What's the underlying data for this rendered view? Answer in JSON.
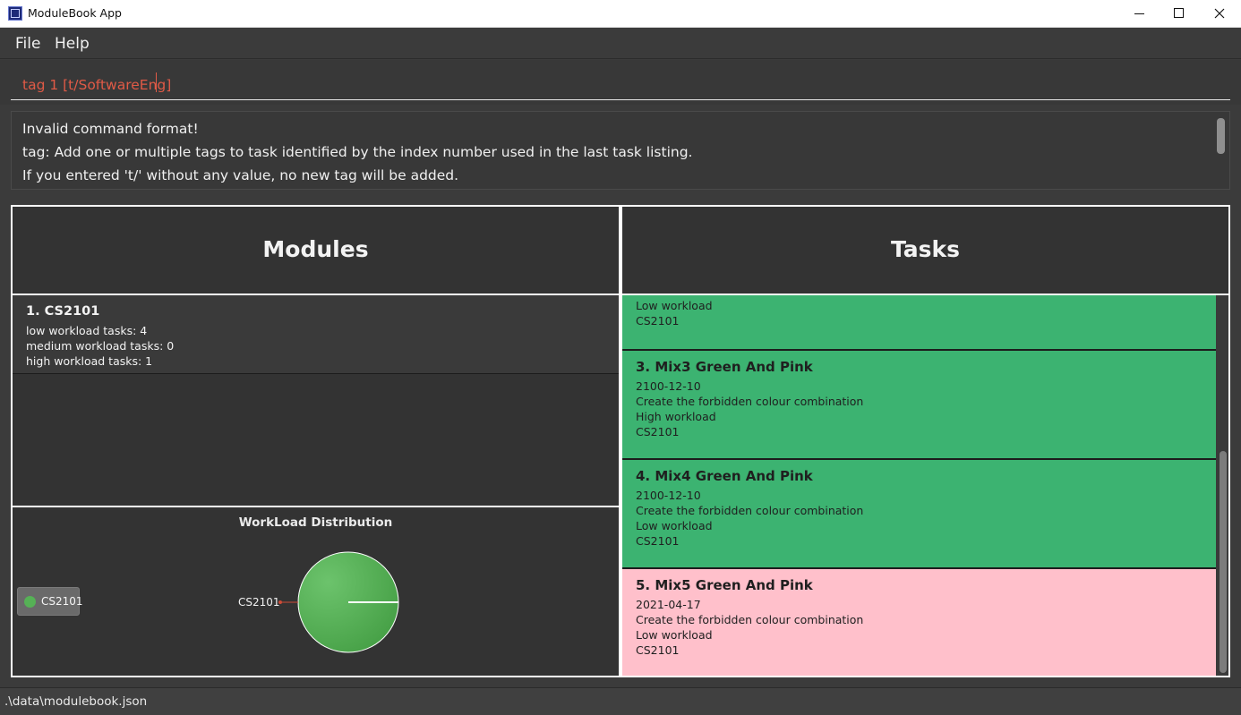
{
  "window": {
    "title": "ModuleBook App"
  },
  "menu": {
    "file": "File",
    "help": "Help"
  },
  "command": {
    "value": "tag 1 [t/SoftwareEng]"
  },
  "result": {
    "lines": [
      "Invalid command format!",
      "tag: Add one or multiple tags to task identified by the index number used in the last task listing.",
      "If you entered 't/' without any value, no new tag will be added."
    ]
  },
  "modules": {
    "title": "Modules",
    "items": [
      {
        "name": "1.  CS2101",
        "low": "low workload tasks: 4",
        "medium": "medium workload tasks: 0",
        "high": "high workload tasks: 1"
      }
    ]
  },
  "workload_chart": {
    "title": "WorkLoad Distribution",
    "legend": "CS2101",
    "slice_label": "CS2101"
  },
  "chart_data": {
    "type": "pie",
    "title": "WorkLoad Distribution",
    "categories": [
      "CS2101"
    ],
    "values": [
      100
    ],
    "legend": "left",
    "colors": [
      "#56b156"
    ]
  },
  "tasks": {
    "title": "Tasks",
    "partial_top": {
      "line1": "Low workload",
      "line2": "CS2101",
      "color": "#3cb371"
    },
    "items": [
      {
        "name": "3.  Mix3 Green And Pink",
        "date": "2100-12-10",
        "desc": "Create the forbidden colour combination",
        "workload": "High workload",
        "module": "CS2101",
        "color": "#3cb371"
      },
      {
        "name": "4.  Mix4 Green And Pink",
        "date": "2100-12-10",
        "desc": "Create the forbidden colour combination",
        "workload": "Low workload",
        "module": "CS2101",
        "color": "#3cb371"
      },
      {
        "name": "5.  Mix5 Green And Pink",
        "date": "2021-04-17",
        "desc": "Create the forbidden colour combination",
        "workload": "Low workload",
        "module": "CS2101",
        "color": "#ffc0cb"
      }
    ]
  },
  "status": {
    "path": ".\\data\\modulebook.json"
  }
}
